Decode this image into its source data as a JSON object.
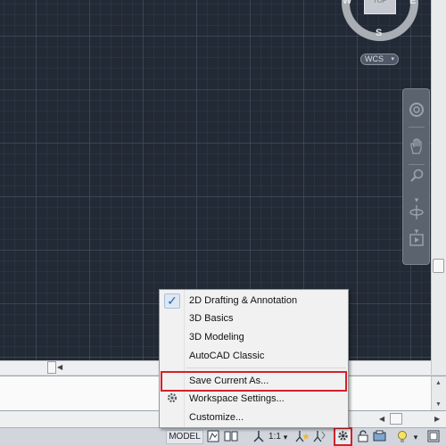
{
  "viewcube": {
    "face_label": "TOP",
    "north": "",
    "west": "W",
    "east": "E",
    "south": "S",
    "ucs_label": "WCS",
    "ucs_arrow": "▾"
  },
  "navbar": {
    "tools": [
      "steering-wheel-icon",
      "pan-hand-icon",
      "zoom-magnifier-icon",
      "orbit-icon",
      "showmotion-icon"
    ]
  },
  "workspace_menu": {
    "items": [
      {
        "label": "2D Drafting & Annotation",
        "checked": true,
        "icon": "checkmark-icon"
      },
      {
        "label": "3D Basics",
        "checked": false
      },
      {
        "label": "3D Modeling",
        "checked": false
      },
      {
        "label": "AutoCAD Classic",
        "checked": false
      }
    ],
    "actions": [
      {
        "label": "Save Current As...",
        "highlighted": true
      },
      {
        "label": "Workspace Settings...",
        "icon": "gear-icon"
      },
      {
        "label": "Customize..."
      }
    ]
  },
  "statusbar": {
    "model_label": "MODEL",
    "annotation_scale": "1:1",
    "scale_arrow": "▾",
    "icons": [
      "quick-view-layouts-icon",
      "quick-view-drawings-icon",
      "annotation-scale-icon",
      "annotation-visibility-icon",
      "auto-scale-icon",
      "workspace-switching-gear-icon",
      "lock-icon",
      "hardware-acceleration-icon",
      "isolate-objects-icon",
      "clean-screen-icon"
    ]
  },
  "colors": {
    "canvas_bg": "#222a36",
    "highlight_red": "#d62028",
    "check_blue": "#2464b6"
  }
}
